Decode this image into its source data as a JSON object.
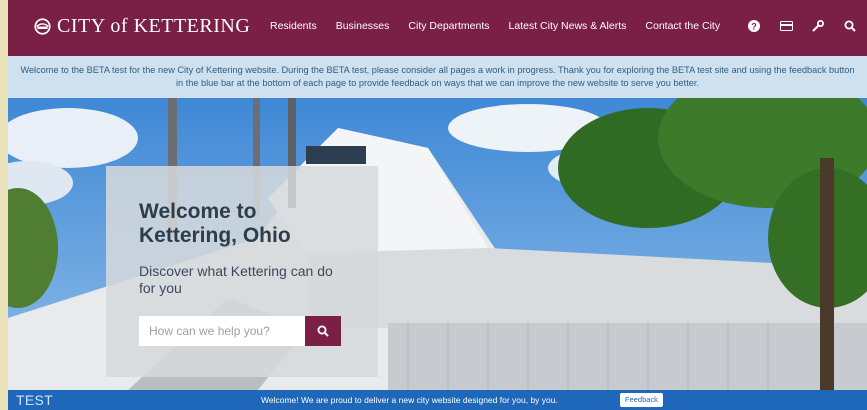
{
  "header": {
    "site_name": "CITY of KETTERING",
    "nav": [
      "Residents",
      "Businesses",
      "City Departments",
      "Latest City News & Alerts",
      "Contact the City"
    ],
    "icons": [
      "help-icon",
      "payment-card-icon",
      "wrench-icon",
      "search-icon"
    ]
  },
  "beta_banner": {
    "text": "Welcome to the BETA test for the new City of Kettering website.  During the BETA test, please consider all pages a work in progress.  Thank you for exploring the BETA test site and using the feedback button in the blue bar at the bottom of each page to provide feedback on ways that we can improve the new website to serve you better."
  },
  "hero": {
    "title": "Welcome to Kettering, Ohio",
    "subtitle": "Discover what Kettering can do for you",
    "search_placeholder": "How can we help you?"
  },
  "footer_bar": {
    "label": "TEST",
    "message": "Welcome! We are proud to deliver a new city website designed for you, by you.",
    "feedback_label": "Feedback"
  },
  "colors": {
    "brand": "#7a1f45",
    "banner_bg": "#cfe0ee",
    "banner_text": "#2c5f86",
    "bottom_bar": "#1f67b8"
  }
}
